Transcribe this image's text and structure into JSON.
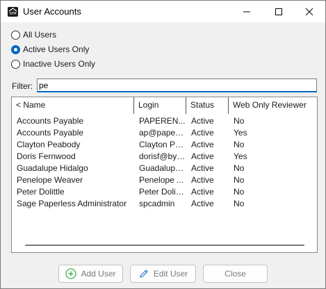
{
  "window": {
    "title": "User Accounts",
    "app_icon_text": "SPM"
  },
  "filters": {
    "options": [
      {
        "label": "All Users",
        "checked": false
      },
      {
        "label": "Active Users Only",
        "checked": true
      },
      {
        "label": "Inactive Users Only",
        "checked": false
      }
    ],
    "filter_label": "Filter:",
    "filter_value": "pe"
  },
  "table": {
    "columns": [
      "< Name",
      "Login",
      "Status",
      "Web Only Reviewer"
    ],
    "rows": [
      {
        "name": "Accounts Payable",
        "login": "PAPEREN...",
        "status": "Active",
        "web_only": "No"
      },
      {
        "name": "Accounts Payable",
        "login": "ap@paperl...",
        "status": "Active",
        "web_only": "Yes"
      },
      {
        "name": "Clayton Peabody",
        "login": "Clayton Pe...",
        "status": "Active",
        "web_only": "No"
      },
      {
        "name": "Doris Fernwood",
        "login": "dorisf@byh...",
        "status": "Active",
        "web_only": "Yes"
      },
      {
        "name": "Guadalupe Hidalgo",
        "login": "Guadalupe...",
        "status": "Active",
        "web_only": "No"
      },
      {
        "name": "Penelope Weaver",
        "login": "Penelope ...",
        "status": "Active",
        "web_only": "No"
      },
      {
        "name": "Peter Dolittle",
        "login": "Peter Dolittle",
        "status": "Active",
        "web_only": "No"
      },
      {
        "name": "Sage Paperless Administrator",
        "login": "spcadmin",
        "status": "Active",
        "web_only": "No"
      }
    ]
  },
  "buttons": {
    "add_user": "Add User",
    "edit_user": "Edit User",
    "close": "Close"
  },
  "colors": {
    "accent": "#0067c0",
    "add_icon": "#4caf50",
    "edit_icon": "#3a7bd5"
  }
}
